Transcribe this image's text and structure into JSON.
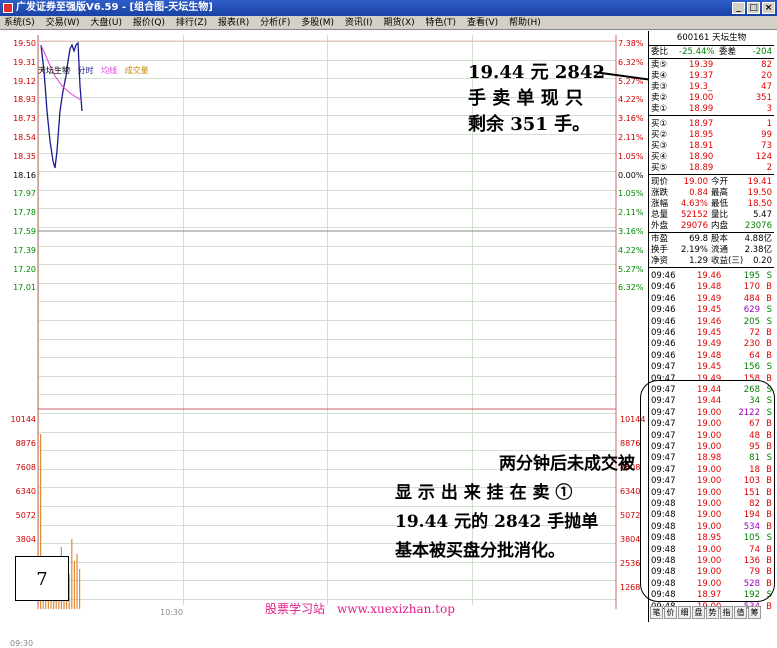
{
  "window": {
    "title": "广发证券至强版V6.59 - [组合图-天坛生物]",
    "minimize": "_",
    "maximize": "□",
    "close": "×"
  },
  "menu": [
    "系统(S)",
    "交易(W)",
    "大盘(U)",
    "报价(Q)",
    "排行(Z)",
    "报表(R)",
    "分析(F)",
    "多股(M)",
    "资讯(I)",
    "期货(X)",
    "特色(T)",
    "查看(V)",
    "帮助(H)"
  ],
  "chart": {
    "stock_label": "天坛生物",
    "legend": [
      "分时",
      "均线",
      "成交量"
    ],
    "price_ticks": [
      "19.50",
      "19.31",
      "19.12",
      "18.93",
      "18.73",
      "18.54",
      "18.35",
      "18.16",
      "17.97",
      "17.78",
      "17.59",
      "17.39",
      "17.20",
      "17.01"
    ],
    "pct_ticks": [
      "7.38%",
      "6.32%",
      "5.27%",
      "4.22%",
      "3.16%",
      "2.11%",
      "1.05%",
      "0.00%",
      "1.05%",
      "2.11%",
      "3.16%",
      "4.22%",
      "5.27%",
      "6.32%"
    ],
    "volume_ticks": [
      "10144",
      "8876",
      "7608",
      "6340",
      "5072",
      "3804"
    ],
    "volume_ticks_right": [
      "10144",
      "8876",
      "7608",
      "6340",
      "5072",
      "3804",
      "2536",
      "1268"
    ],
    "time_labels": [
      "09:30",
      "10:30"
    ]
  },
  "figure_number": "7",
  "annotation_top": [
    "19.44 元 2842",
    "手 卖 单 现 只",
    "剩余 351 手。"
  ],
  "annotation_bottom": [
    "两分钟后未成交被",
    "显 示 出 来 挂 在 卖 ①",
    "19.44 元的 2842 手抛单",
    "基本被买盘分批消化。"
  ],
  "watermark": "股票学习站　www.xuexizhan.top",
  "quote": {
    "code_name": "600161 天坛生物",
    "weibi_label": "委比",
    "weibi": "-25.44%",
    "weicha_label": "委差",
    "weicha": "-204",
    "asks": [
      {
        "label": "卖⑤",
        "price": "19.39",
        "vol": "82"
      },
      {
        "label": "卖④",
        "price": "19.37",
        "vol": "20"
      },
      {
        "label": "卖③",
        "price": "19.3_",
        "vol": "47"
      },
      {
        "label": "卖②",
        "price": "19.00",
        "vol": "351"
      },
      {
        "label": "卖①",
        "price": "18.99",
        "vol": "3"
      }
    ],
    "bids": [
      {
        "label": "买①",
        "price": "18.97",
        "vol": "1"
      },
      {
        "label": "买②",
        "price": "18.95",
        "vol": "99"
      },
      {
        "label": "买③",
        "price": "18.91",
        "vol": "73"
      },
      {
        "label": "买④",
        "price": "18.90",
        "vol": "124"
      },
      {
        "label": "买⑤",
        "price": "18.89",
        "vol": "2"
      }
    ],
    "stats": [
      {
        "l1": "现价",
        "v1": "19.00",
        "l2": "今开",
        "v2": "19.41"
      },
      {
        "l1": "涨跌",
        "v1": "0.84",
        "l2": "最高",
        "v2": "19.50"
      },
      {
        "l1": "涨幅",
        "v1": "4.63%",
        "l2": "最低",
        "v2": "18.50"
      },
      {
        "l1": "总量",
        "v1": "52152",
        "l2": "量比",
        "v2": "5.47"
      },
      {
        "l1": "外盘",
        "v1": "29076",
        "l2": "内盘",
        "v2": "23076"
      }
    ],
    "stats2": [
      {
        "l1": "市盈",
        "v1": "69.8",
        "l2": "股本",
        "v2": "4.88亿"
      },
      {
        "l1": "换手",
        "v1": "2.19%",
        "l2": "流通",
        "v2": "2.38亿"
      },
      {
        "l1": "净资",
        "v1": "1.29",
        "l2": "收益(三)",
        "v2": "0.20"
      }
    ]
  },
  "ticks": [
    {
      "t": "09:46",
      "p": "19.46",
      "v": "195",
      "bs": "S"
    },
    {
      "t": "09:46",
      "p": "19.48",
      "v": "170",
      "bs": "B"
    },
    {
      "t": "09:46",
      "p": "19.49",
      "v": "484",
      "bs": "B"
    },
    {
      "t": "09:46",
      "p": "19.45",
      "v": "629",
      "bs": "S"
    },
    {
      "t": "09:46",
      "p": "19.46",
      "v": "205",
      "bs": "S"
    },
    {
      "t": "09:46",
      "p": "19.45",
      "v": "72",
      "bs": "B"
    },
    {
      "t": "09:46",
      "p": "19.49",
      "v": "230",
      "bs": "B"
    },
    {
      "t": "09:46",
      "p": "19.48",
      "v": "64",
      "bs": "B"
    },
    {
      "t": "09:47",
      "p": "19.45",
      "v": "156",
      "bs": "S"
    },
    {
      "t": "09:47",
      "p": "19.49",
      "v": "158",
      "bs": "B"
    },
    {
      "t": "09:47",
      "p": "19.44",
      "v": "268",
      "bs": "S"
    },
    {
      "t": "09:47",
      "p": "19.44",
      "v": "34",
      "bs": "S"
    },
    {
      "t": "09:47",
      "p": "19.00",
      "v": "2122",
      "bs": "S"
    },
    {
      "t": "09:47",
      "p": "19.00",
      "v": "67",
      "bs": "B"
    },
    {
      "t": "09:47",
      "p": "19.00",
      "v": "48",
      "bs": "B"
    },
    {
      "t": "09:47",
      "p": "19.00",
      "v": "95",
      "bs": "B"
    },
    {
      "t": "09:47",
      "p": "18.98",
      "v": "81",
      "bs": "S"
    },
    {
      "t": "09:47",
      "p": "19.00",
      "v": "18",
      "bs": "B"
    },
    {
      "t": "09:47",
      "p": "19.00",
      "v": "103",
      "bs": "B"
    },
    {
      "t": "09:47",
      "p": "19.00",
      "v": "151",
      "bs": "B"
    },
    {
      "t": "09:48",
      "p": "19.00",
      "v": "82",
      "bs": "B"
    },
    {
      "t": "09:48",
      "p": "19.00",
      "v": "194",
      "bs": "B"
    },
    {
      "t": "09:48",
      "p": "19.00",
      "v": "534",
      "bs": "B"
    },
    {
      "t": "09:48",
      "p": "18.95",
      "v": "105",
      "bs": "S"
    },
    {
      "t": "09:48",
      "p": "19.00",
      "v": "74",
      "bs": "B"
    },
    {
      "t": "09:48",
      "p": "19.00",
      "v": "136",
      "bs": "B"
    },
    {
      "t": "09:48",
      "p": "19.00",
      "v": "79",
      "bs": "B"
    },
    {
      "t": "09:48",
      "p": "19.00",
      "v": "528",
      "bs": "B"
    },
    {
      "t": "09:48",
      "p": "18.97",
      "v": "192",
      "bs": "S"
    },
    {
      "t": "09:48",
      "p": "19.00",
      "v": "534",
      "bs": "B"
    }
  ],
  "panel_tabs": [
    "笔",
    "价",
    "细",
    "盘",
    "势",
    "指",
    "值",
    "筹"
  ]
}
